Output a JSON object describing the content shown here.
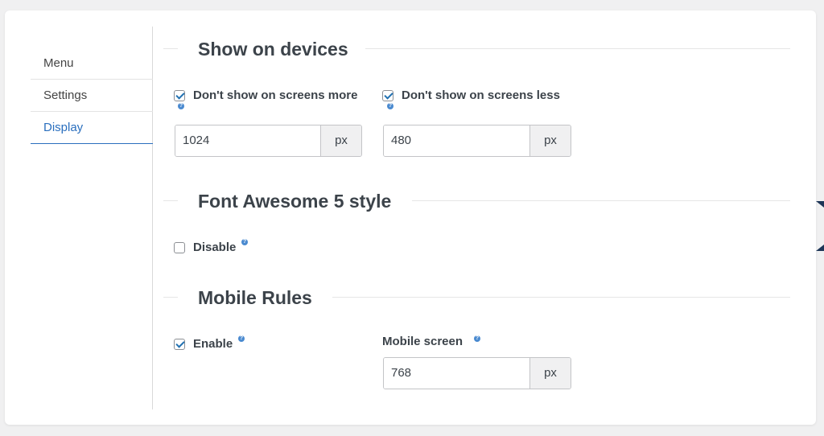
{
  "sidebar": {
    "tabs": [
      {
        "label": "Menu"
      },
      {
        "label": "Settings"
      },
      {
        "label": "Display"
      }
    ]
  },
  "sections": {
    "devices": {
      "title": "Show on devices",
      "more": {
        "label": "Don't show on screens more",
        "checked": true,
        "value": "1024",
        "unit": "px"
      },
      "less": {
        "label": "Don't show on screens less",
        "checked": true,
        "value": "480",
        "unit": "px"
      }
    },
    "fontawesome": {
      "title": "Font Awesome 5 style",
      "disable": {
        "label": "Disable",
        "checked": false
      }
    },
    "mobile": {
      "title": "Mobile Rules",
      "enable": {
        "label": "Enable",
        "checked": true
      },
      "screen": {
        "label": "Mobile screen",
        "value": "768",
        "unit": "px"
      }
    }
  },
  "help_glyph": "?",
  "colors": {
    "accent": "#2a6fbe",
    "help": "#4a8ad0",
    "edge": "#1d3557"
  }
}
